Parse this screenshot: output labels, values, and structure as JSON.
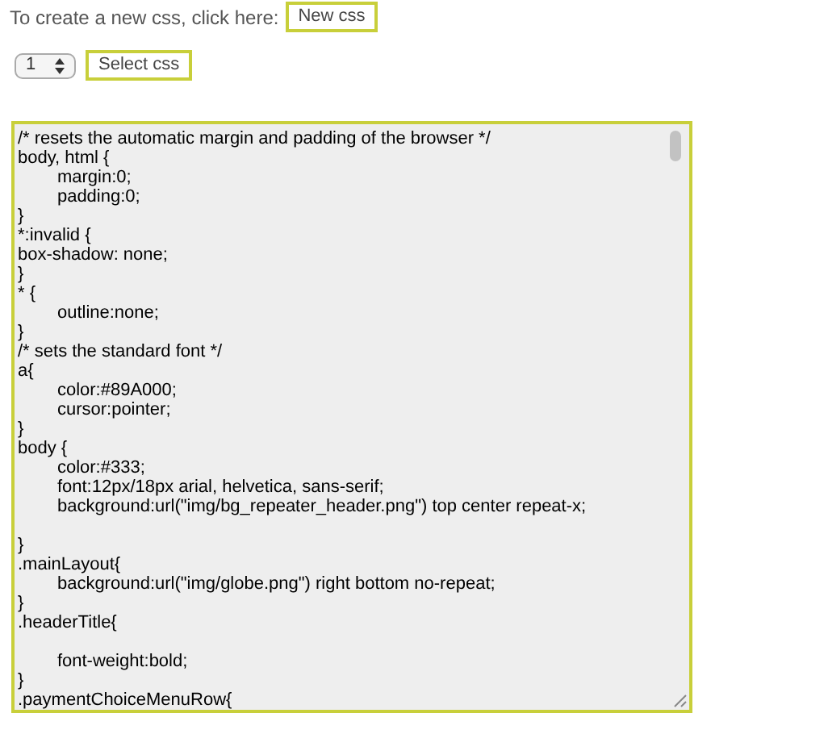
{
  "intro": {
    "text": "To create a new css, click here:",
    "button": "New css"
  },
  "select": {
    "value": "1",
    "button": "Select css"
  },
  "editor": {
    "value": "/* resets the automatic margin and padding of the browser */\nbody, html {\n\tmargin:0;\n\tpadding:0;\n}\n*:invalid {\nbox-shadow: none;\n}\n* {\n\toutline:none;\n}\n/* sets the standard font */\na{\n\tcolor:#89A000;\n\tcursor:pointer;\n}\nbody {\n\tcolor:#333;\n\tfont:12px/18px arial, helvetica, sans-serif;\n\tbackground:url(\"img/bg_repeater_header.png\") top center repeat-x;\n\n}\n.mainLayout{\n\tbackground:url(\"img/globe.png\") right bottom no-repeat;\n}\n.headerTitle{\n\n\tfont-weight:bold;\n}\n.paymentChoiceMenuRow{"
  }
}
